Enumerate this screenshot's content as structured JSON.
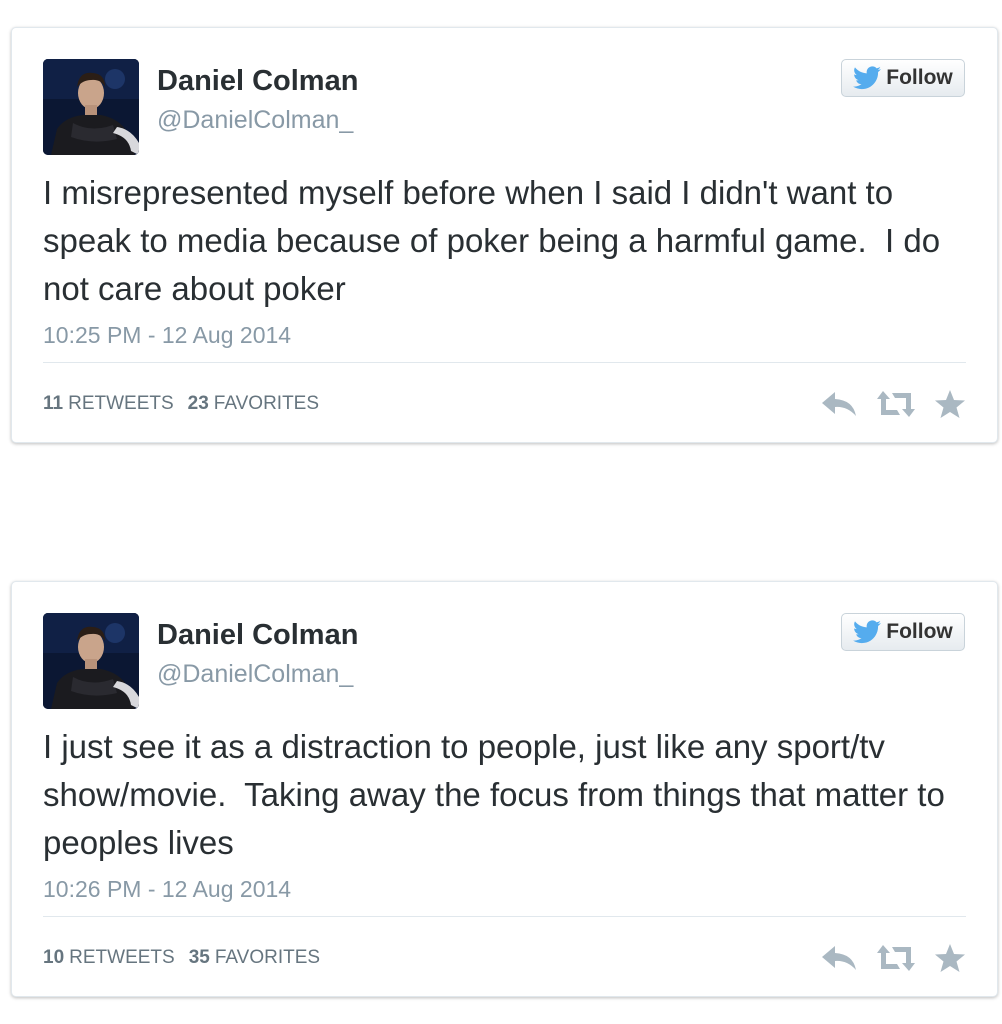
{
  "colors": {
    "name": "#292f33",
    "muted": "#8899a6",
    "twitter_blue": "#55acee",
    "action_gray": "#aab8c2"
  },
  "tweets": [
    {
      "author_name": "Daniel Colman",
      "author_handle": "@DanielColman_",
      "follow_label": "Follow",
      "text": "I misrepresented myself before when I said I didn't want to speak to media because of poker being a harmful game.  I do not care about poker",
      "timestamp": "10:25 PM - 12 Aug 2014",
      "retweets_count": "11",
      "retweets_label": "RETWEETS",
      "favorites_count": "23",
      "favorites_label": "FAVORITES",
      "icons": [
        "reply-icon",
        "retweet-icon",
        "favorite-star-icon",
        "twitter-bird-icon"
      ]
    },
    {
      "author_name": "Daniel Colman",
      "author_handle": "@DanielColman_",
      "follow_label": "Follow",
      "text": "I just see it as a distraction to people, just like any sport/tv show/movie.  Taking away the focus from things that matter to peoples lives",
      "timestamp": "10:26 PM - 12 Aug 2014",
      "retweets_count": "10",
      "retweets_label": "RETWEETS",
      "favorites_count": "35",
      "favorites_label": "FAVORITES",
      "icons": [
        "reply-icon",
        "retweet-icon",
        "favorite-star-icon",
        "twitter-bird-icon"
      ]
    }
  ]
}
